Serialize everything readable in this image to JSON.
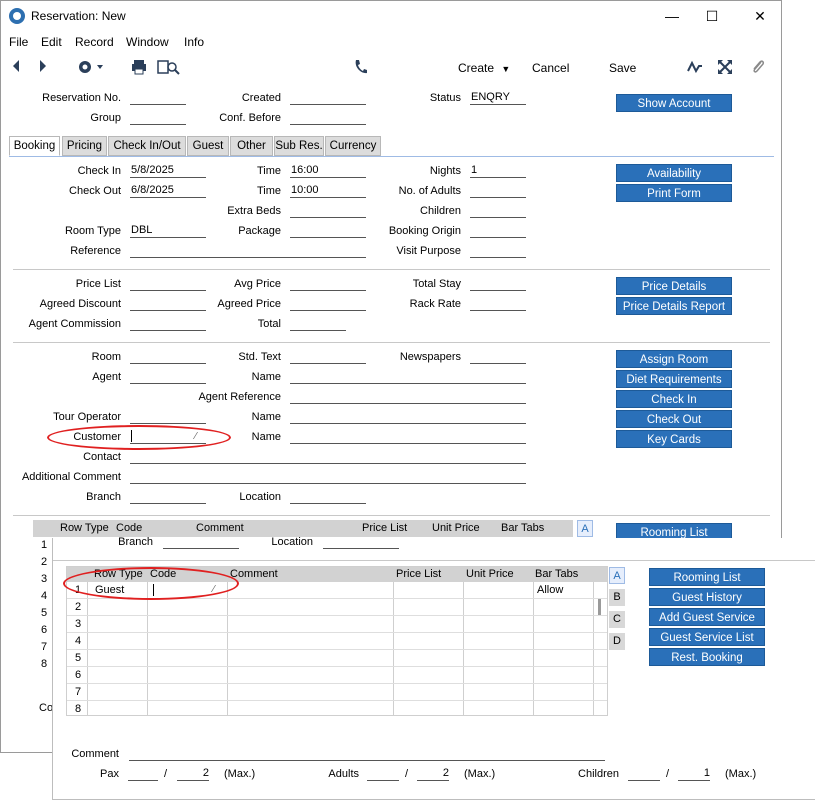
{
  "window": {
    "title": "Reservation: New",
    "minimize": "—",
    "maximize": "☐",
    "close": "✕"
  },
  "menu": [
    "File",
    "Edit",
    "Record",
    "Window",
    "Info"
  ],
  "toolbar": {
    "create": "Create",
    "cancel": "Cancel",
    "save": "Save"
  },
  "header": {
    "reservation_no_label": "Reservation No.",
    "reservation_no": "",
    "created_label": "Created",
    "created": "",
    "status_label": "Status",
    "status": "ENQRY",
    "group_label": "Group",
    "group": "",
    "conf_before_label": "Conf. Before",
    "conf_before": "",
    "show_account": "Show Account"
  },
  "tabs": [
    "Booking",
    "Pricing",
    "Check In/Out",
    "Guest",
    "Other",
    "Sub Res.",
    "Currency"
  ],
  "booking": {
    "check_in_label": "Check In",
    "check_in": "5/8/2025",
    "time1_label": "Time",
    "time1": "16:00",
    "nights_label": "Nights",
    "nights": "1",
    "check_out_label": "Check Out",
    "check_out": "6/8/2025",
    "time2_label": "Time",
    "time2": "10:00",
    "adults_label": "No. of Adults",
    "extra_beds_label": "Extra Beds",
    "children_label": "Children",
    "room_type_label": "Room Type",
    "room_type": "DBL",
    "package_label": "Package",
    "booking_origin_label": "Booking Origin",
    "reference_label": "Reference",
    "visit_purpose_label": "Visit Purpose",
    "availability": "Availability",
    "print_form": "Print Form"
  },
  "pricing": {
    "price_list_label": "Price List",
    "avg_price_label": "Avg Price",
    "total_stay_label": "Total Stay",
    "agreed_discount_label": "Agreed Discount",
    "agreed_price_label": "Agreed Price",
    "rack_rate_label": "Rack Rate",
    "agent_commission_label": "Agent Commission",
    "total_label": "Total",
    "price_details": "Price Details",
    "price_details_report": "Price Details Report"
  },
  "room": {
    "room_label": "Room",
    "std_text_label": "Std. Text",
    "newspapers_label": "Newspapers",
    "agent_label": "Agent",
    "name_label": "Name",
    "agent_reference_label": "Agent Reference",
    "tour_operator_label": "Tour Operator",
    "customer_label": "Customer",
    "contact_label": "Contact",
    "additional_comment_label": "Additional Comment",
    "branch_label": "Branch",
    "location_label": "Location",
    "assign_room": "Assign Room",
    "diet_requirements": "Diet Requirements",
    "check_in": "Check In",
    "check_out": "Check Out",
    "key_cards": "Key Cards"
  },
  "back_grid": {
    "headers": [
      "Row Type",
      "Code",
      "Comment",
      "Price List",
      "Unit Price",
      "Bar Tabs"
    ],
    "rows": [
      "1",
      "2",
      "3",
      "4",
      "5",
      "6",
      "7",
      "8"
    ],
    "side_tab": "A",
    "rooming_list": "Rooming List",
    "comment_label_partial": "Co"
  },
  "overlay": {
    "branch_label": "Branch",
    "location_label": "Location",
    "headers": [
      "Row Type",
      "Code",
      "Comment",
      "Price List",
      "Unit Price",
      "Bar Tabs"
    ],
    "rows": [
      {
        "n": "1",
        "row_type": "Guest",
        "bar_tabs": "Allow"
      },
      {
        "n": "2"
      },
      {
        "n": "3"
      },
      {
        "n": "4"
      },
      {
        "n": "5"
      },
      {
        "n": "6"
      },
      {
        "n": "7"
      },
      {
        "n": "8"
      }
    ],
    "side_tabs": [
      "A",
      "B",
      "C",
      "D"
    ],
    "buttons": [
      "Rooming List",
      "Guest History",
      "Add Guest Service",
      "Guest Service List",
      "Rest. Booking"
    ],
    "comment_label": "Comment",
    "pax_label": "Pax",
    "pax_max": "2",
    "adults_label": "Adults",
    "adults_max": "2",
    "children_label": "Children",
    "children_max": "1",
    "max_label": "(Max.)",
    "slash": "/"
  },
  "icons": [
    "back-icon",
    "forward-icon",
    "gear-icon",
    "print-icon",
    "search-icon",
    "phone-icon",
    "pulse-icon",
    "expand-icon",
    "paperclip-icon"
  ]
}
